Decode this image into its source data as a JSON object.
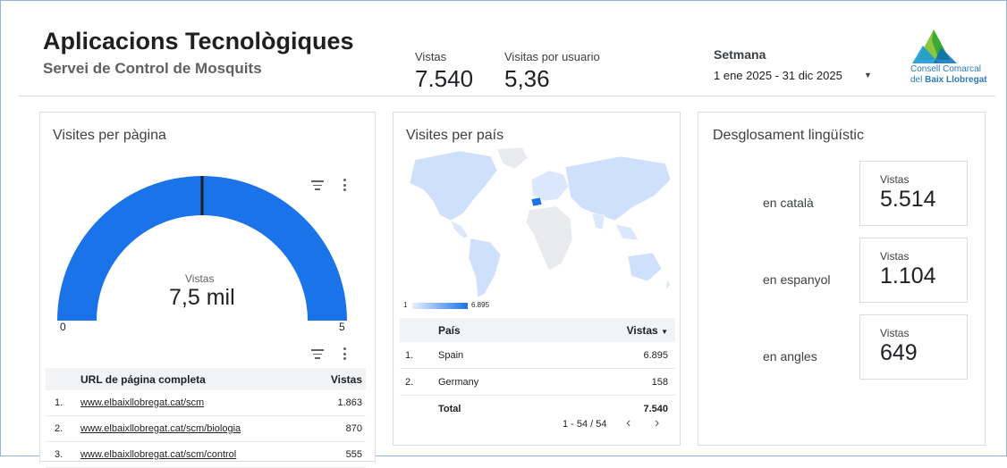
{
  "header": {
    "title": "Aplicacions Tecnològiques",
    "subtitle": "Servei de Control de Mosquits",
    "kpis": [
      {
        "label": "Vistas",
        "value": "7.540"
      },
      {
        "label": "Visitas por usuario",
        "value": "5,36"
      }
    ],
    "period": {
      "label": "Setmana",
      "value": "1 ene 2025 - 31 dic 2025"
    },
    "logo": {
      "line1": "Consell Comarcal",
      "line2_prefix": "del ",
      "line2_bold": "Baix Llobregat"
    }
  },
  "page_visits": {
    "title": "Visites per pàgina",
    "gauge": {
      "label": "Vistas",
      "value_text": "7,5 mil",
      "min": "0",
      "max": "5",
      "target_fraction": 0.5,
      "color": "#1a73e8"
    },
    "table": {
      "headers": [
        "URL de página completa",
        "Vistas"
      ],
      "rows": [
        {
          "n": "1.",
          "url": "www.elbaixllobregat.cat/scm",
          "views": "1.863"
        },
        {
          "n": "2.",
          "url": "www.elbaixllobregat.cat/scm/biologia",
          "views": "870"
        },
        {
          "n": "3.",
          "url": "www.elbaixllobregat.cat/scm/control",
          "views": "555"
        }
      ]
    }
  },
  "country_visits": {
    "title": "Visites per país",
    "legend": {
      "min": "1",
      "max": "6.895"
    },
    "table": {
      "headers": [
        "País",
        "Vistas"
      ],
      "sort_icon": "sort-desc-icon",
      "rows": [
        {
          "n": "1.",
          "country": "Spain",
          "views": "6.895"
        },
        {
          "n": "2.",
          "country": "Germany",
          "views": "158"
        }
      ],
      "total_label": "Total",
      "total_value": "7.540"
    },
    "pager": {
      "text": "1 - 54 / 54",
      "prev": "‹",
      "next": "›"
    }
  },
  "language": {
    "title": "Desglosament lingüístic",
    "items": [
      {
        "lang": "en català",
        "label": "Vistas",
        "value": "5.514"
      },
      {
        "lang": "en espanyol",
        "label": "Vistas",
        "value": "1.104"
      },
      {
        "lang": "en angles",
        "label": "Vistas",
        "value": "649"
      }
    ]
  }
}
